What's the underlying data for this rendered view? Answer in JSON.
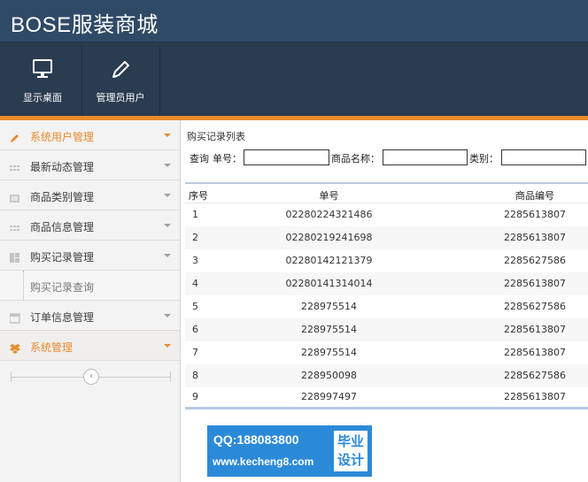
{
  "app": {
    "title": "BOSE服装商城"
  },
  "topnav": [
    {
      "label": "显示桌面",
      "icon": "monitor-icon"
    },
    {
      "label": "管理员用户",
      "icon": "pencil-icon"
    }
  ],
  "sidebar": {
    "items": [
      {
        "label": "系统用户管理",
        "icon": "pencil-icon",
        "active": true
      },
      {
        "label": "最新动态管理",
        "icon": "grid-dots-icon",
        "active": false
      },
      {
        "label": "商品类别管理",
        "icon": "folder-icon",
        "active": false
      },
      {
        "label": "商品信息管理",
        "icon": "grid-dots-icon",
        "active": false
      },
      {
        "label": "购买记录管理",
        "icon": "dashboard-icon",
        "active": false
      },
      {
        "label": "订单信息管理",
        "icon": "calendar-icon",
        "active": false
      },
      {
        "label": "系统管理",
        "icon": "dropbox-icon",
        "active": true
      }
    ],
    "subitem": "购买记录查询"
  },
  "main": {
    "breadcrumb": "购买记录列表",
    "search": {
      "prefix": "查询",
      "order_label": "单号：",
      "product_label": "商品名称：",
      "category_label": "类别：",
      "order_value": "",
      "product_value": "",
      "category_value": ""
    },
    "table": {
      "headers": [
        "序号",
        "单号",
        "商品编号"
      ],
      "rows": [
        [
          "1",
          "02280224321486",
          "2285613807"
        ],
        [
          "2",
          "02280219241698",
          "2285613807"
        ],
        [
          "3",
          "02280142121379",
          "2285627586"
        ],
        [
          "4",
          "02280141314014",
          "2285613807"
        ],
        [
          "5",
          "228975514",
          "2285627586"
        ],
        [
          "6",
          "228975514",
          "2285613807"
        ],
        [
          "7",
          "228975514",
          "2285613807"
        ],
        [
          "8",
          "228950098",
          "2285627586"
        ],
        [
          "9",
          "228997497",
          "2285613807"
        ]
      ]
    }
  },
  "watermark": {
    "qq": "QQ:188083800",
    "url": "www.kecheng8.com",
    "tag_line1": "毕业",
    "tag_line2": "设计"
  },
  "colors": {
    "header_bg": "#2e4257",
    "accent_orange": "#e98a2c",
    "sidebar_bg": "#f3f3f3",
    "table_border": "#b8c9dd",
    "watermark_blue": "#2b8ad8"
  }
}
